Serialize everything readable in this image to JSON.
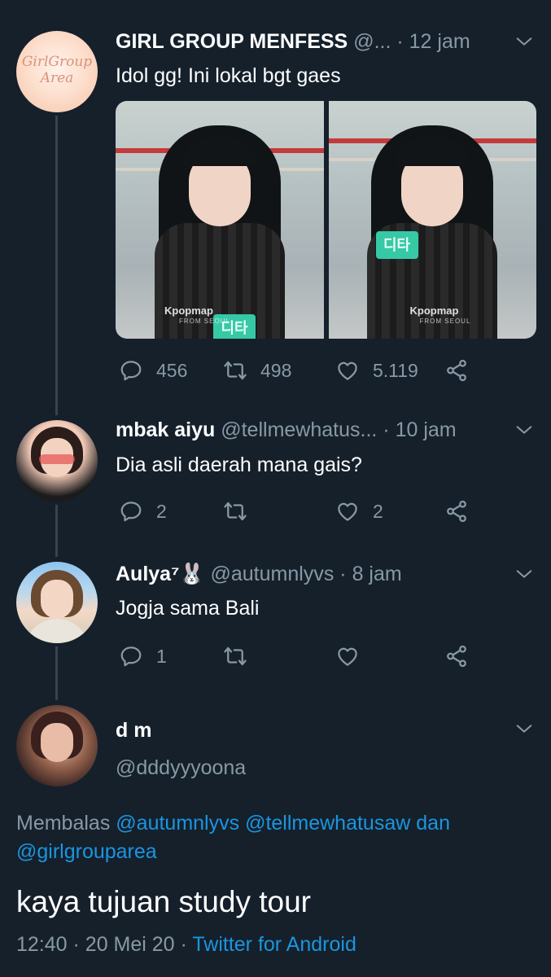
{
  "thread": [
    {
      "display_name": "GIRL GROUP MENFESS",
      "handle": "@...",
      "time": "12 jam",
      "text": "Idol gg! Ini lokal bgt gaes",
      "avatar_text": [
        "GirlGroup",
        "Area"
      ],
      "media_watermark": "Kpopmap",
      "media_watermark_sub": [
        "FROM SEOUL",
        "FROM SEOUL"
      ],
      "media_sign": "디타",
      "counts": {
        "reply": "456",
        "retweet": "498",
        "like": "5.119"
      }
    },
    {
      "display_name": "mbak aiyu",
      "handle": "@tellmewhatus...",
      "time": "10 jam",
      "text": "Dia asli daerah mana gais?",
      "counts": {
        "reply": "2",
        "retweet": "",
        "like": "2"
      }
    },
    {
      "display_name": "Aulya⁷",
      "emoji": "🐰",
      "handle": "@autumnlyvs",
      "time": "8 jam",
      "text": "Jogja sama Bali",
      "counts": {
        "reply": "1",
        "retweet": "",
        "like": ""
      }
    }
  ],
  "main_tweet": {
    "display_name": "d m",
    "handle": "@dddyyyoona",
    "reply_prefix": "Membalas",
    "reply_mentions": [
      "@autumnlyvs",
      "@tellmewhatusaw",
      "@girlgrouparea"
    ],
    "reply_joiner": "dan",
    "text": "kaya tujuan study tour",
    "time": "12:40",
    "date": "20 Mei 20",
    "source": "Twitter for Android"
  },
  "separator": "·",
  "colors": {
    "background": "#15202b",
    "text_primary": "#ffffff",
    "text_secondary": "#8899a6",
    "link": "#1b95e0",
    "thread_line": "#38444d"
  },
  "icons": [
    "reply-icon",
    "retweet-icon",
    "like-icon",
    "share-icon",
    "chevron-down-icon"
  ]
}
